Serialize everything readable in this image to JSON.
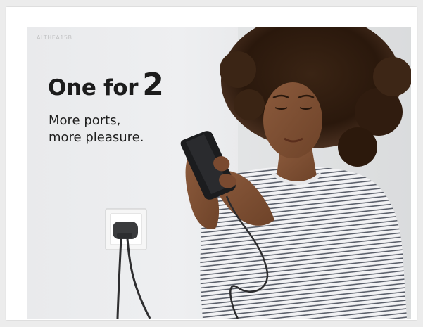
{
  "ad": {
    "watermark": "ALTHEA15B",
    "headline_text": "One for",
    "headline_number": "2",
    "subline_1": "More ports,",
    "subline_2": "more pleasure."
  },
  "colors": {
    "background": "#ececec",
    "frame": "#ffffff",
    "text": "#1c1c1c",
    "charger": "#3a3b3d",
    "shirt_stripe": "#5a5f6a"
  },
  "icons": [
    "wall-socket-icon",
    "usb-charger-icon",
    "phone-icon"
  ]
}
